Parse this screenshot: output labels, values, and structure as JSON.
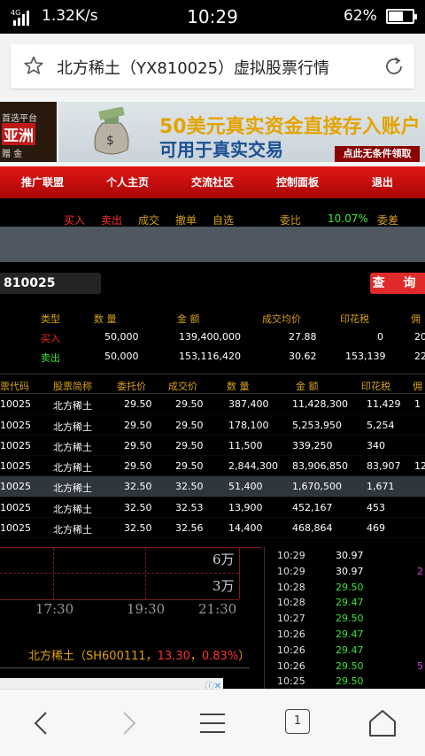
{
  "status_bar": {
    "network": "4G",
    "speed": "1.32K/s",
    "time": "10:29",
    "battery": "62%",
    "battery_level": 0.62
  },
  "browser": {
    "title": "北方稀土（YX810025）虚拟股票行情",
    "tab_count": "1"
  },
  "banner": {
    "logo_line1": "首选平台",
    "logo_line2": "亚洲",
    "logo_line3": "赠 金",
    "headline": "50美元真实资金直接存入账户",
    "subline": "可用于真实交易",
    "cta": "点此无条件领取"
  },
  "nav": {
    "items": [
      "推广联盟",
      "个人主页",
      "交流社区",
      "控制面板",
      "退出"
    ]
  },
  "top_row": {
    "tabs": [
      "买入",
      "卖出",
      "成交",
      "撤单",
      "自选"
    ],
    "ratio_label": "委比",
    "ratio_value": "10.07%",
    "spread_label": "委差"
  },
  "query": {
    "code": "810025",
    "button": "查 询"
  },
  "summary": {
    "headers": [
      "类型",
      "数 量",
      "金 额",
      "成交均价",
      "印花税",
      "佣"
    ],
    "rows": [
      {
        "type": "买入",
        "qty": "50,000",
        "amount": "139,400,000",
        "avg": "27.88",
        "tax": "0",
        "fee": "20"
      },
      {
        "type": "卖出",
        "qty": "50,000",
        "amount": "153,116,420",
        "avg": "30.62",
        "tax": "153,139",
        "fee": "22"
      }
    ]
  },
  "trades": {
    "headers": [
      "票代码",
      "股票简称",
      "委托价",
      "成交价",
      "数 量",
      "金 额",
      "印花税",
      "佣"
    ],
    "rows": [
      {
        "code": "10025",
        "name": "北方稀土",
        "order": "29.50",
        "deal": "29.50",
        "qty": "387,400",
        "amount": "11,428,300",
        "tax": "11,429",
        "fee": "1"
      },
      {
        "code": "10025",
        "name": "北方稀土",
        "order": "29.50",
        "deal": "29.50",
        "qty": "178,100",
        "amount": "5,253,950",
        "tax": "5,254",
        "fee": ""
      },
      {
        "code": "10025",
        "name": "北方稀土",
        "order": "29.50",
        "deal": "29.50",
        "qty": "11,500",
        "amount": "339,250",
        "tax": "340",
        "fee": ""
      },
      {
        "code": "10025",
        "name": "北方稀土",
        "order": "29.50",
        "deal": "29.50",
        "qty": "2,844,300",
        "amount": "83,906,850",
        "tax": "83,907",
        "fee": "12"
      },
      {
        "code": "10025",
        "name": "北方稀土",
        "order": "32.50",
        "deal": "32.50",
        "qty": "51,400",
        "amount": "1,670,500",
        "tax": "1,671",
        "fee": ""
      },
      {
        "code": "10025",
        "name": "北方稀土",
        "order": "32.50",
        "deal": "32.53",
        "qty": "13,900",
        "amount": "452,167",
        "tax": "453",
        "fee": ""
      },
      {
        "code": "10025",
        "name": "北方稀土",
        "order": "32.50",
        "deal": "32.56",
        "qty": "14,400",
        "amount": "468,864",
        "tax": "469",
        "fee": ""
      }
    ]
  },
  "chart": {
    "y_labels": [
      "6万",
      "3万"
    ],
    "x_labels": [
      "17:30",
      "19:30",
      "21:30"
    ]
  },
  "stock_line": {
    "name": "北方稀土（SH600111，",
    "price": "13.30",
    "sep": "，",
    "change": "0.83%",
    "close": "）"
  },
  "ticks": [
    {
      "time": "10:29",
      "price": "30.97",
      "color": "#ffffff",
      "extra": ""
    },
    {
      "time": "10:29",
      "price": "30.97",
      "color": "#ffffff",
      "extra": "2"
    },
    {
      "time": "10:28",
      "price": "29.50",
      "color": "#39e639",
      "extra": ""
    },
    {
      "time": "10:28",
      "price": "29.47",
      "color": "#39e639",
      "extra": ""
    },
    {
      "time": "10:27",
      "price": "29.50",
      "color": "#39e639",
      "extra": ""
    },
    {
      "time": "10:26",
      "price": "29.47",
      "color": "#39e639",
      "extra": ""
    },
    {
      "time": "10:26",
      "price": "29.47",
      "color": "#39e639",
      "extra": ""
    },
    {
      "time": "10:26",
      "price": "29.50",
      "color": "#39e639",
      "extra": "5"
    },
    {
      "time": "10:25",
      "price": "29.50",
      "color": "#39e639",
      "extra": ""
    }
  ],
  "colors": {
    "buy": "#ff2a2a",
    "sell": "#39e639",
    "header": "#d4a017",
    "nav": "#d60e0e"
  },
  "icons": [
    "star-icon",
    "reload-icon",
    "back-icon",
    "forward-icon",
    "menu-icon",
    "home-icon"
  ]
}
